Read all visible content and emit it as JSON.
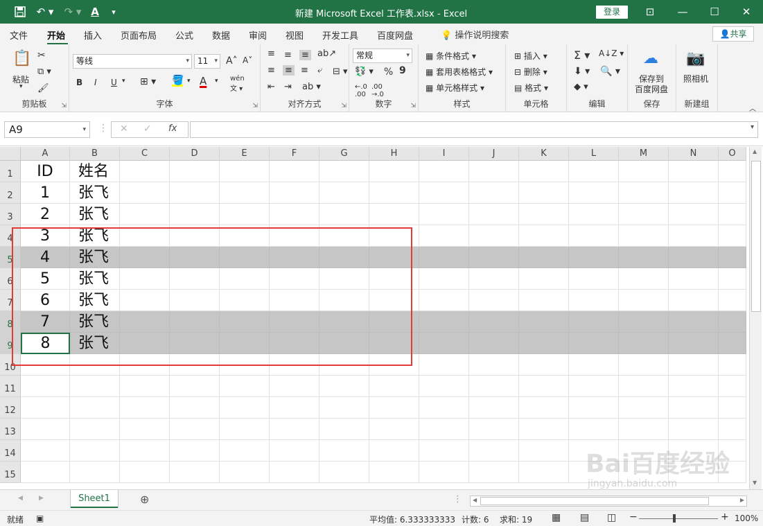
{
  "titlebar": {
    "title": "新建 Microsoft Excel 工作表.xlsx  -  Excel",
    "login": "登录",
    "save_icon": "save-icon",
    "undo_icon": "undo-icon",
    "redo_icon": "redo-icon"
  },
  "tabs": [
    "文件",
    "开始",
    "插入",
    "页面布局",
    "公式",
    "数据",
    "审阅",
    "视图",
    "开发工具",
    "百度网盘"
  ],
  "tell_me": "操作说明搜索",
  "share": "共享",
  "ribbon": {
    "clipboard": {
      "paste": "粘贴",
      "label": "剪贴板"
    },
    "font": {
      "name": "等线",
      "size": "11",
      "bold": "B",
      "italic": "I",
      "underline": "U",
      "label": "字体"
    },
    "alignment": {
      "label": "对齐方式"
    },
    "number": {
      "format": "常规",
      "percent": "%",
      "comma": "9",
      "label": "数字"
    },
    "styles": {
      "conditional": "条件格式",
      "table": "套用表格格式",
      "cell": "单元格样式",
      "label": "样式"
    },
    "cells": {
      "insert": "插入",
      "delete": "删除",
      "format": "格式",
      "label": "单元格"
    },
    "editing": {
      "label": "编辑"
    },
    "save": {
      "line1": "保存到",
      "line2": "百度网盘",
      "label": "保存"
    },
    "camera": {
      "label_top": "照相机",
      "label": "新建组"
    }
  },
  "namebox": "A9",
  "formula": "",
  "columns": [
    "A",
    "B",
    "C",
    "D",
    "E",
    "F",
    "G",
    "H",
    "I",
    "J",
    "K",
    "L",
    "M",
    "N",
    "O"
  ],
  "rows": [
    {
      "n": "1",
      "a": "ID",
      "b": "姓名",
      "sel": false
    },
    {
      "n": "2",
      "a": "1",
      "b": "张飞",
      "sel": false
    },
    {
      "n": "3",
      "a": "2",
      "b": "张飞",
      "sel": false
    },
    {
      "n": "4",
      "a": "3",
      "b": "张飞",
      "sel": false
    },
    {
      "n": "5",
      "a": "4",
      "b": "张飞",
      "sel": true
    },
    {
      "n": "6",
      "a": "5",
      "b": "张飞",
      "sel": false
    },
    {
      "n": "7",
      "a": "6",
      "b": "张飞",
      "sel": false
    },
    {
      "n": "8",
      "a": "7",
      "b": "张飞",
      "sel": true
    },
    {
      "n": "9",
      "a": "8",
      "b": "张飞",
      "sel": true
    },
    {
      "n": "10",
      "a": "",
      "b": "",
      "sel": false
    },
    {
      "n": "11",
      "a": "",
      "b": "",
      "sel": false
    },
    {
      "n": "12",
      "a": "",
      "b": "",
      "sel": false
    },
    {
      "n": "13",
      "a": "",
      "b": "",
      "sel": false
    },
    {
      "n": "14",
      "a": "",
      "b": "",
      "sel": false
    },
    {
      "n": "15",
      "a": "",
      "b": "",
      "sel": false
    }
  ],
  "sheet": "Sheet1",
  "status": {
    "ready": "就绪",
    "average": "平均值: 6.333333333",
    "count": "计数: 6",
    "sum": "求和: 19",
    "zoom": "100%"
  },
  "watermark": {
    "brand": "Bai百度经验",
    "url": "jingyan.baidu.com"
  },
  "colors": {
    "accent": "#217346",
    "highlight": "#e53935",
    "selected_row": "#c6c6c6"
  }
}
